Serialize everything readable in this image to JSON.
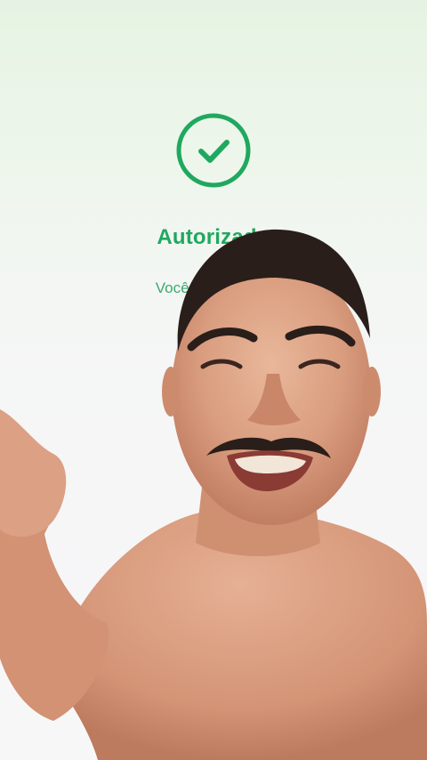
{
  "app": {
    "accent_color": "#1fa85f",
    "status_icon": "check-circle-icon"
  },
  "main": {
    "title": "Autorizado",
    "subtitle": "Você já autorizou"
  },
  "overlay": {
    "description": "video-overlay-person"
  }
}
